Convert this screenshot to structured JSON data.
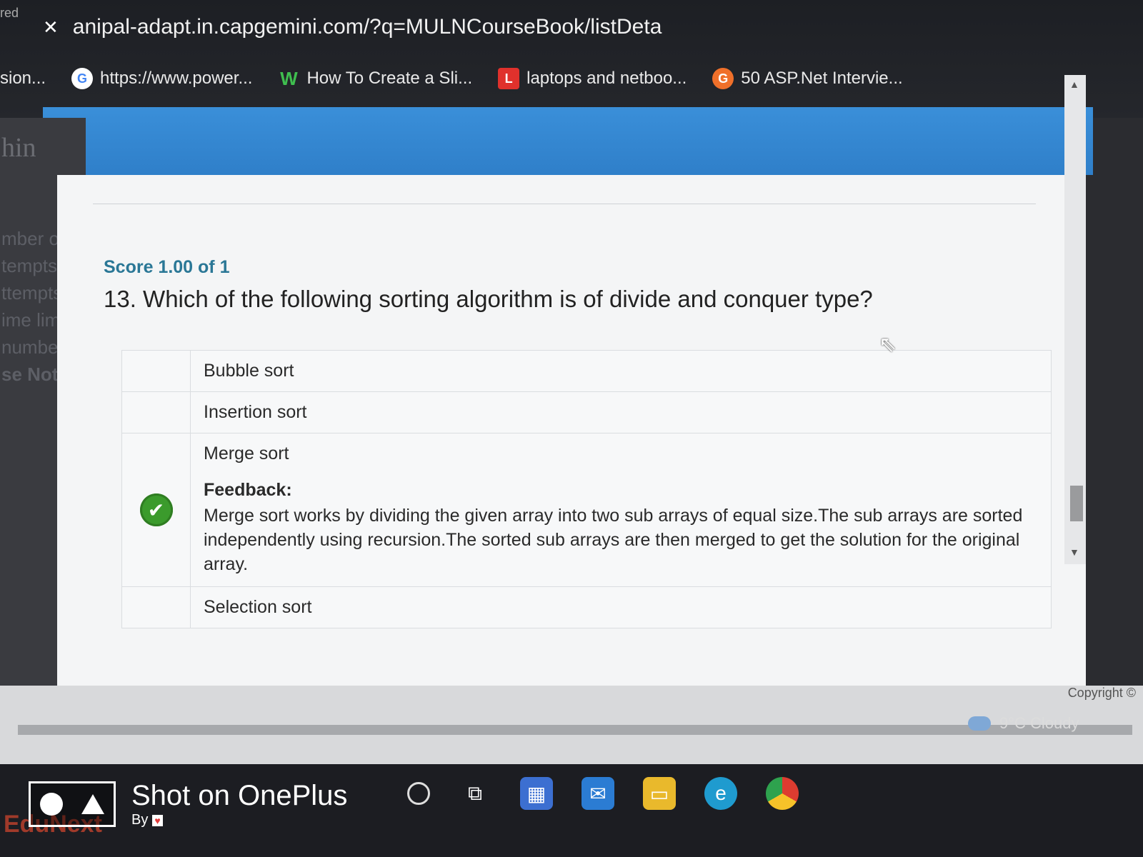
{
  "browser": {
    "url": "anipal-adapt.in.capgemini.com/?q=MULNCourseBook/listDeta",
    "bookmarks": [
      {
        "icon": "google-icon",
        "label": "https://www.power..."
      },
      {
        "icon": "w-icon",
        "label": "How To Create a Sli..."
      },
      {
        "icon": "l-icon",
        "label": "laptops and netboo..."
      },
      {
        "icon": "orange-circle-icon",
        "label": "50 ASP.Net Intervie..."
      }
    ],
    "bookmark_prefix": "sion...",
    "tab_prefix": "red"
  },
  "sidebar": {
    "title": "hin",
    "items": [
      "mber o",
      "tempts",
      "ttempts",
      "ime limit",
      "number o",
      "se Note :"
    ]
  },
  "quiz": {
    "score": "Score 1.00 of 1",
    "question": "13. Which of the following sorting algorithm is of divide and conquer type?",
    "options": [
      "Bubble sort",
      "Insertion sort",
      "Merge sort",
      "Selection sort"
    ],
    "correct_index": 2,
    "feedback_title": "Feedback:",
    "feedback_text": "Merge sort works by dividing the given array into two sub arrays of equal size.The sub arrays are sorted independently using recursion.The sorted sub arrays are then merged to get the solution for the original array."
  },
  "footer": {
    "copyright": "Copyright ©"
  },
  "taskbar": {
    "weather": "9°C  Cloudy",
    "icons": [
      "search-icon",
      "task-view-icon",
      "store-icon",
      "mail-icon",
      "file-explorer-icon",
      "edge-icon",
      "chrome-icon"
    ]
  },
  "watermark": {
    "main": "Shot on OnePlus",
    "sub": "By"
  },
  "corner_text": "EduNext"
}
